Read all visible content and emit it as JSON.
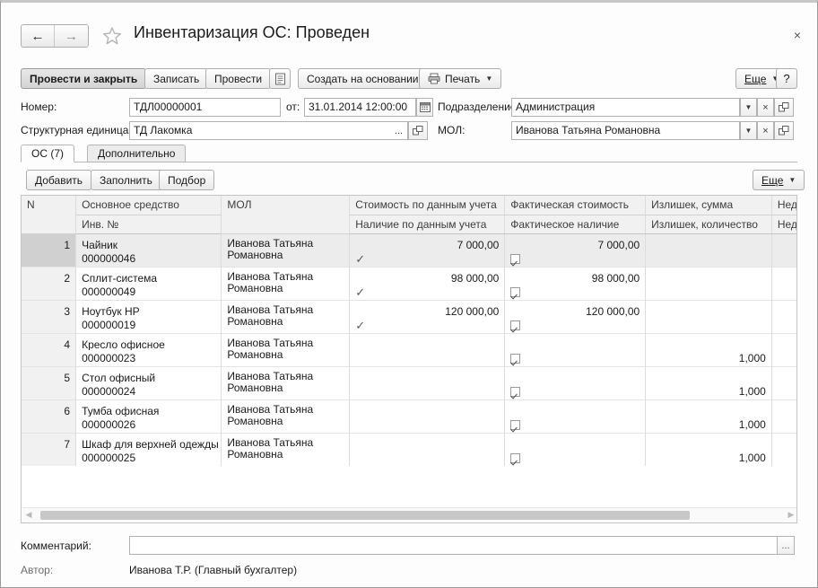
{
  "window": {
    "title": "Инвентаризация ОС: Проведен",
    "back_icon": "arrow-left-icon",
    "forward_icon": "arrow-right-icon",
    "favorite_icon": "star-icon",
    "close_label": "×"
  },
  "command_bar": {
    "post_and_close": "Провести и закрыть",
    "write": "Записать",
    "post": "Провести",
    "doc_icon": "document-icon",
    "create_based_on": "Создать на основании",
    "print": "Печать",
    "print_icon": "printer-icon",
    "more": "Еще",
    "help": "?"
  },
  "header_fields": {
    "number_label": "Номер:",
    "number_value": "ТДЛ00000001",
    "date_prefix": "от:",
    "date_value": "31.01.2014 12:00:00",
    "calendar_icon": "calendar-icon",
    "division_label": "Подразделение:",
    "division_value": "Администрация",
    "unit_label": "Структурная единица:",
    "unit_value": "ТД Лакомка",
    "unit_pick": "...",
    "mol_label": "МОЛ:",
    "mol_value": "Иванова Татьяна Романовна",
    "dropdown_icon": "chevron-down-icon",
    "clear_icon": "clear-x-icon",
    "open_icon": "open-external-icon"
  },
  "tabs": [
    {
      "label": "ОС (7)",
      "active": true
    },
    {
      "label": "Дополнительно",
      "active": false
    }
  ],
  "grid_toolbar": {
    "add": "Добавить",
    "fill": "Заполнить",
    "select": "Подбор",
    "more": "Еще"
  },
  "table": {
    "columns": [
      {
        "top": "N",
        "bottom": ""
      },
      {
        "top": "Основное средство",
        "bottom": "Инв. №"
      },
      {
        "top": "МОЛ",
        "bottom": ""
      },
      {
        "top": "Стоимость по данным учета",
        "bottom": "Наличие по данным учета"
      },
      {
        "top": "Фактическая стоимость",
        "bottom": "Фактическое наличие"
      },
      {
        "top": "Излишек, сумма",
        "bottom": "Излишек, количество"
      },
      {
        "top": "Недостача, сумма",
        "bottom": "Недостача, количество"
      }
    ],
    "rows": [
      {
        "n": "1",
        "name": "Чайник",
        "inv": "000000046",
        "mol": "Иванова Татьяна Романовна",
        "cost_accounting": "7 000,00",
        "present_accounting": true,
        "cost_actual": "7 000,00",
        "present_actual": true,
        "surplus_sum": "",
        "surplus_qty": "",
        "shortage_sum": "",
        "shortage_qty": "",
        "selected": true
      },
      {
        "n": "2",
        "name": "Сплит-система",
        "inv": "000000049",
        "mol": "Иванова Татьяна Романовна",
        "cost_accounting": "98 000,00",
        "present_accounting": true,
        "cost_actual": "98 000,00",
        "present_actual": true,
        "surplus_sum": "",
        "surplus_qty": "",
        "shortage_sum": "",
        "shortage_qty": "",
        "selected": false
      },
      {
        "n": "3",
        "name": "Ноутбук HP",
        "inv": "000000019",
        "mol": "Иванова Татьяна Романовна",
        "cost_accounting": "120 000,00",
        "present_accounting": true,
        "cost_actual": "120 000,00",
        "present_actual": true,
        "surplus_sum": "",
        "surplus_qty": "",
        "shortage_sum": "",
        "shortage_qty": "",
        "selected": false
      },
      {
        "n": "4",
        "name": "Кресло офисное",
        "inv": "000000023",
        "mol": "Иванова Татьяна Романовна",
        "cost_accounting": "",
        "present_accounting": false,
        "cost_actual": "",
        "present_actual": true,
        "surplus_sum": "",
        "surplus_qty": "1,000",
        "shortage_sum": "",
        "shortage_qty": "",
        "selected": false
      },
      {
        "n": "5",
        "name": "Стол офисный",
        "inv": "000000024",
        "mol": "Иванова Татьяна Романовна",
        "cost_accounting": "",
        "present_accounting": false,
        "cost_actual": "",
        "present_actual": true,
        "surplus_sum": "",
        "surplus_qty": "1,000",
        "shortage_sum": "",
        "shortage_qty": "",
        "selected": false
      },
      {
        "n": "6",
        "name": "Тумба офисная",
        "inv": "000000026",
        "mol": "Иванова Татьяна Романовна",
        "cost_accounting": "",
        "present_accounting": false,
        "cost_actual": "",
        "present_actual": true,
        "surplus_sum": "",
        "surplus_qty": "1,000",
        "shortage_sum": "",
        "shortage_qty": "",
        "selected": false
      },
      {
        "n": "7",
        "name": "Шкаф для верхней одежды",
        "inv": "000000025",
        "mol": "Иванова Татьяна Романовна",
        "cost_accounting": "",
        "present_accounting": false,
        "cost_actual": "",
        "present_actual": true,
        "surplus_sum": "",
        "surplus_qty": "1,000",
        "shortage_sum": "",
        "shortage_qty": "",
        "selected": false
      }
    ]
  },
  "footer": {
    "comment_label": "Комментарий:",
    "comment_value": "",
    "comment_pick": "...",
    "author_label": "Автор:",
    "author_value": "Иванова Т.Р. (Главный бухгалтер)"
  }
}
